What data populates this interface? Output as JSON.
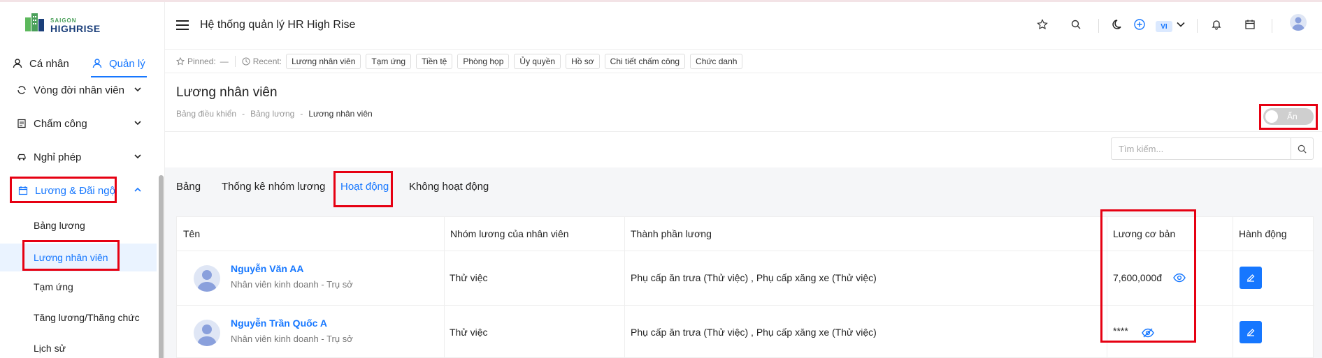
{
  "brand": {
    "line1": "SAIGON",
    "line2": "HIGHRISE"
  },
  "role_tabs": [
    {
      "label": "Cá nhân"
    },
    {
      "label": "Quản lý"
    }
  ],
  "menu": {
    "items": [
      {
        "label": "Vòng đời nhân viên"
      },
      {
        "label": "Chấm công"
      },
      {
        "label": "Nghỉ phép"
      },
      {
        "label": "Lương & Đãi ngộ"
      }
    ],
    "sub_items": [
      {
        "label": "Bảng lương"
      },
      {
        "label": "Lương nhân viên"
      },
      {
        "label": "Tạm ứng"
      },
      {
        "label": "Tăng lương/Thăng chức"
      },
      {
        "label": "Lịch sử"
      }
    ]
  },
  "header": {
    "title": "Hệ thống quản lý HR High Rise",
    "lang": "VI"
  },
  "pinbar": {
    "pinned_label": "Pinned:",
    "pinned_value": "—",
    "recent_label": "Recent:",
    "recent": [
      "Lương nhân viên",
      "Tạm ứng",
      "Tiền tệ",
      "Phòng họp",
      "Ủy quyền",
      "Hồ sơ",
      "Chi tiết chấm công",
      "Chức danh"
    ]
  },
  "page": {
    "title": "Lương nhân viên",
    "breadcrumb": [
      "Bảng điều khiển",
      "Bảng lương",
      "Lương nhân viên"
    ],
    "breadcrumb_sep": "-",
    "toggle_label": "Ẩn"
  },
  "search": {
    "placeholder": "Tìm kiếm..."
  },
  "tabs": [
    {
      "label": "Bảng"
    },
    {
      "label": "Thống kê nhóm lương"
    },
    {
      "label": "Hoạt động"
    },
    {
      "label": "Không hoạt động"
    }
  ],
  "table": {
    "columns": [
      "Tên",
      "Nhóm lương của nhân viên",
      "Thành phần lương",
      "Lương cơ bản",
      "Hành động"
    ],
    "rows": [
      {
        "name": "Nguyễn Văn AA",
        "sub": "Nhân viên kinh doanh - Trụ sở",
        "group": "Thử việc",
        "components": "Phụ cấp ăn trưa (Thử việc) , Phụ cấp xăng xe (Thử việc)",
        "salary": "7,600,000đ"
      },
      {
        "name": "Nguyễn Trần Quốc A",
        "sub": "Nhân viên kinh doanh - Trụ sở",
        "group": "Thử việc",
        "components": "Phụ cấp ăn trưa (Thử việc) , Phụ cấp xăng xe (Thử việc)",
        "salary": "****"
      }
    ]
  },
  "colors": {
    "accent": "#1677ff",
    "highlight": "#e60012"
  }
}
